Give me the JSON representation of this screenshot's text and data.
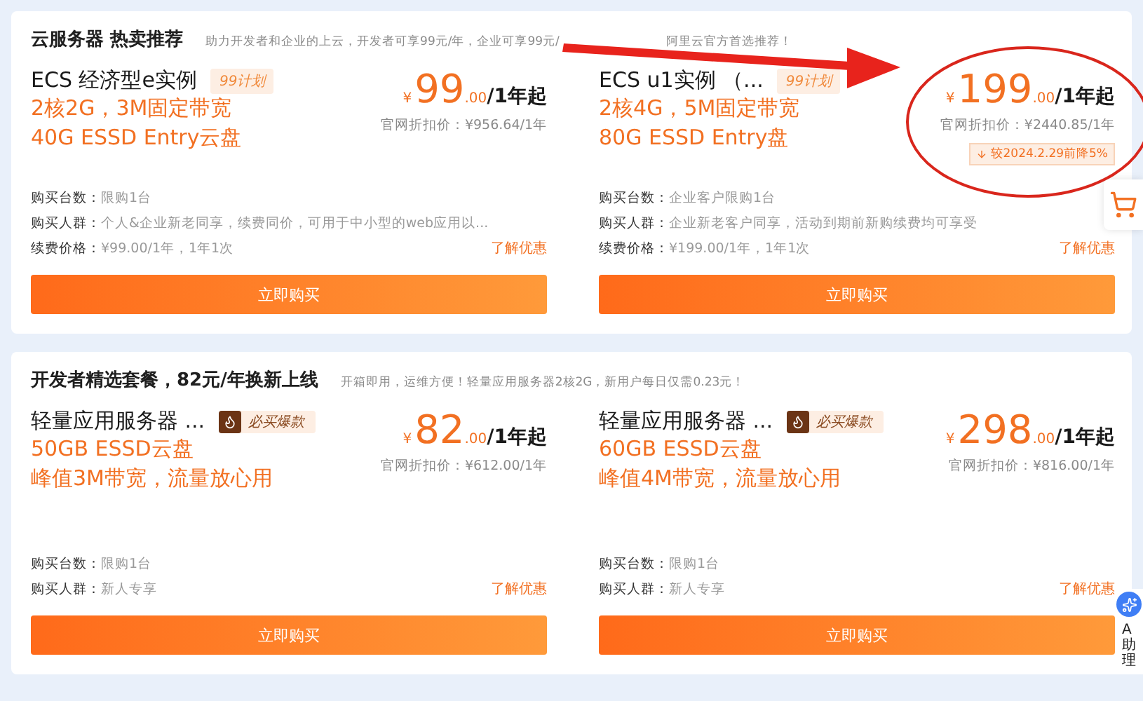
{
  "sections": [
    {
      "title": "云服务器 热卖推荐",
      "subtitle": [
        "助力开发者和企业的上云，开发者可享99元/年，企业可享99元/",
        "阿里云官方首选推荐！"
      ],
      "products": [
        {
          "name": "ECS 经济型e实例",
          "tag": {
            "kind": "plan",
            "text": "99计划"
          },
          "specs": [
            "2核2G，3M固定带宽",
            "40G ESSD Entry云盘"
          ],
          "price": {
            "currency": "¥",
            "integer": "99",
            "decimals": ".00",
            "unit": "/1年起"
          },
          "list_price": "官网折扣价：¥956.64/1年",
          "details": [
            {
              "label": "购买台数：",
              "value": "限购1台"
            },
            {
              "label": "购买人群：",
              "value": "个人&企业新老同享，续费同价，可用于中小型的web应用以..."
            },
            {
              "label": "续费价格：",
              "value": "¥99.00/1年，1年1次"
            }
          ],
          "link": "了解优惠",
          "button": "立即购买"
        },
        {
          "name": "ECS u1实例 （...",
          "tag": {
            "kind": "plan",
            "text": "99计划"
          },
          "specs": [
            "2核4G，5M固定带宽",
            "80G ESSD Entry盘"
          ],
          "price": {
            "currency": "¥",
            "integer": "199",
            "decimals": ".00",
            "unit": "/1年起"
          },
          "list_price": "官网折扣价：¥2440.85/1年",
          "discount_note": "较2024.2.29前降5%",
          "details": [
            {
              "label": "购买台数：",
              "value": "企业客户限购1台"
            },
            {
              "label": "购买人群：",
              "value": "企业新老客户同享，活动到期前新购续费均可享受"
            },
            {
              "label": "续费价格：",
              "value": "¥199.00/1年，1年1次"
            }
          ],
          "link": "了解优惠",
          "button": "立即购买"
        }
      ]
    },
    {
      "title": "开发者精选套餐，82元/年换新上线",
      "subtitle": [
        "开箱即用，运维方便！轻量应用服务器2核2G，新用户每日仅需0.23元！"
      ],
      "products": [
        {
          "name": "轻量应用服务器 ...",
          "tag": {
            "kind": "hot",
            "text": "必买爆款"
          },
          "specs": [
            "50GB ESSD云盘",
            "峰值3M带宽，流量放心用"
          ],
          "price": {
            "currency": "¥",
            "integer": "82",
            "decimals": ".00",
            "unit": "/1年起"
          },
          "list_price": "官网折扣价：¥612.00/1年",
          "details": [
            {
              "label": "购买台数：",
              "value": "限购1台"
            },
            {
              "label": "购买人群：",
              "value": "新人专享"
            }
          ],
          "link": "了解优惠",
          "button": "立即购买"
        },
        {
          "name": "轻量应用服务器 ...",
          "tag": {
            "kind": "hot",
            "text": "必买爆款"
          },
          "specs": [
            "60GB ESSD云盘",
            "峰值4M带宽，流量放心用"
          ],
          "price": {
            "currency": "¥",
            "integer": "298",
            "decimals": ".00",
            "unit": "/1年起"
          },
          "list_price": "官网折扣价：¥816.00/1年",
          "details": [
            {
              "label": "购买台数：",
              "value": "限购1台"
            },
            {
              "label": "购买人群：",
              "value": "新人专享"
            }
          ],
          "link": "了解优惠",
          "button": "立即购买"
        }
      ]
    }
  ],
  "assistant": {
    "label": "A助理"
  }
}
